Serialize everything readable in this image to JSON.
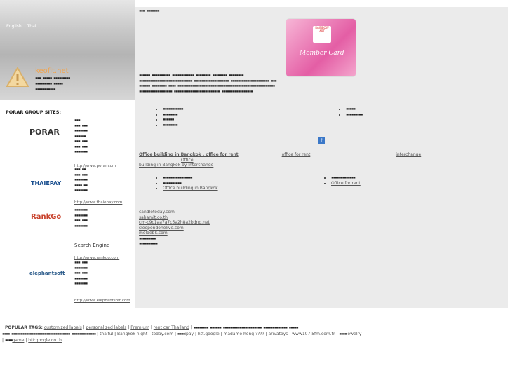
{
  "lang": {
    "english": "English",
    "thai": "Thai"
  },
  "site": {
    "name": "keofit.net"
  },
  "porar_label": "PORAR GROUP SITES:",
  "sites": [
    {
      "logo": "PORAR",
      "link": "http://www.porar.com"
    },
    {
      "logo": "THAIEPAY",
      "link": "http://www.thaiepay.com"
    },
    {
      "logo": "RankGo",
      "link": "http://www.rankgo.com",
      "extra": "Search Engine"
    },
    {
      "logo": "elephantsoft",
      "link": "http://www.elephantsoft.com"
    }
  ],
  "card": {
    "title": "Member Card",
    "badge": "RAINBOW ART"
  },
  "main": {
    "help": "?",
    "office_title": "Office building in Bangkok , office for rent",
    "office_for_rent": "office for rent",
    "interchange": "interchange",
    "office": "Office",
    "building_interchange": "building in Bangkok by Interchange",
    "office_for_rent_link": "Office for rent",
    "office_building_link": "Office building in Bangkok",
    "links": [
      "candletoday.com",
      "sahamit.co.th",
      "cm-c9c1aa7a7c5a2h8a2bdnd.net",
      "sleepondonelive.com",
      "moldebk.com"
    ]
  },
  "footer": {
    "popular": "POPULAR TAGS:",
    "tags": [
      "customized labels",
      "personalized labels",
      "Premium",
      "rent car Thailand",
      "thaiful",
      "Bangkok night - today.com",
      "ipay",
      "htt.google",
      "madame heng ????",
      "arivatoys",
      "www107.5fm.com.tr",
      "jewelry",
      "game",
      "htt:google.co.th"
    ]
  }
}
